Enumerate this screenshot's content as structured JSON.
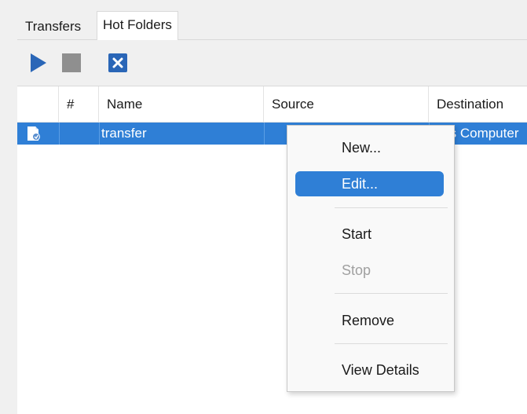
{
  "tabs": [
    {
      "label": "Transfers"
    },
    {
      "label": "Hot Folders",
      "selected": true
    }
  ],
  "toolbar": {
    "buttons": [
      {
        "icon": "play-icon"
      },
      {
        "icon": "stop-icon"
      },
      {
        "icon": "remove-icon"
      }
    ]
  },
  "table": {
    "columns": [
      "",
      "#",
      "Name",
      "Source",
      "Destination"
    ],
    "rows": [
      {
        "icon": "hot-folder-icon",
        "number": "",
        "name": "transfer",
        "source": "",
        "destination": "This Computer"
      }
    ]
  },
  "context_menu": {
    "items": [
      {
        "label": "New...",
        "state": "normal"
      },
      {
        "label": "Edit...",
        "state": "highlighted"
      },
      {
        "label": "Start",
        "state": "normal"
      },
      {
        "label": "Stop",
        "state": "disabled"
      },
      {
        "label": "Remove",
        "state": "normal"
      },
      {
        "label": "View Details",
        "state": "normal"
      }
    ]
  },
  "colors": {
    "selection": "#2f7fd6",
    "play": "#2a66b7",
    "remove": "#2a66b7"
  }
}
